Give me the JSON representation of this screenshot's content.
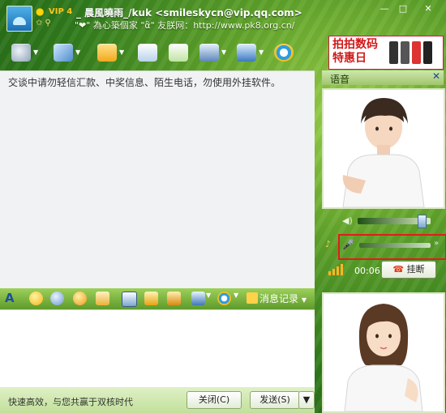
{
  "title": {
    "vip_label": "VIP 4",
    "nickname": "_ 晨風曉雨_/kuk <smileskycn@vip.qq.com>",
    "signature": "\"❤\" 為心築個家 \"ἂ\" 友朕网：http://www.pk8.org.cn/",
    "minimize_glyph": "—",
    "maximize_glyph": "□",
    "close_glyph": "✕"
  },
  "toolbar": {
    "icons": [
      "video-call-icon",
      "voice-call-icon",
      "send-file-icon",
      "send-email-icon",
      "create-group-icon",
      "apps-icon",
      "settings-icon",
      "safe-icon"
    ],
    "dropdown_glyph": "▼"
  },
  "ad": {
    "text": "拍拍数码 特惠日"
  },
  "chat": {
    "notice": "交谈中请勿轻信汇款、中奖信息、陌生电话，勿使用外挂软件。"
  },
  "chat_toolbar": {
    "icons": [
      "font-icon",
      "emoticon-icon",
      "magic-emoticon-icon",
      "nudge-icon",
      "vibrate-icon",
      "image-icon",
      "music-icon",
      "scissors-icon",
      "screen-capture-icon",
      "safe-send-icon"
    ],
    "history_label": "消息记录",
    "dropdown_glyph": "▼"
  },
  "bottom": {
    "slogan": "快速高效，与您共赢于双核时代",
    "close_button": "关闭(C)",
    "send_button": "发送(S)",
    "send_dropdown_glyph": "▼"
  },
  "voice": {
    "title": "语音",
    "close_glyph": "✕",
    "speaker_glyph": "◀)",
    "speaker_volume": 0.88,
    "mic_glyph": "🎤",
    "mic_more_glyph": "»",
    "timer": "00:06",
    "hangup_label": "挂断",
    "hangup_glyph": "☎"
  },
  "colors": {
    "frame_green": "#4e9327",
    "chat_bg": "#f1f2f4",
    "highlight_red": "#e21b1b"
  }
}
